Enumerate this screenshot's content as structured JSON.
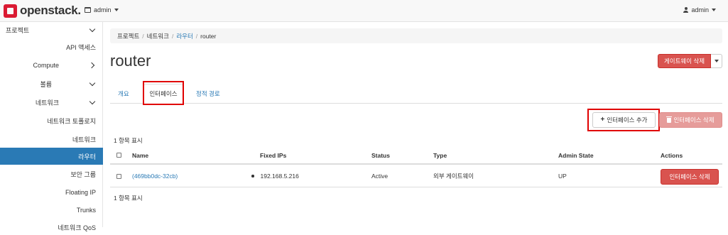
{
  "header": {
    "logo_text": "openstack.",
    "project_menu": "admin",
    "user_menu": "admin"
  },
  "sidebar": {
    "items": [
      {
        "label": "프로젝트",
        "kind": "group",
        "chevron": "down"
      },
      {
        "label": "API 액세스",
        "kind": "sub"
      },
      {
        "label": "Compute",
        "kind": "sub",
        "chevron": "right"
      },
      {
        "label": "볼륨",
        "kind": "sub",
        "chevron": "right"
      },
      {
        "label": "네트워크",
        "kind": "sub",
        "chevron": "down"
      },
      {
        "label": "네트워크 토폴로지",
        "kind": "sub"
      },
      {
        "label": "네트워크",
        "kind": "sub"
      },
      {
        "label": "라우터",
        "kind": "sub",
        "active": true
      },
      {
        "label": "보안 그룹",
        "kind": "sub"
      },
      {
        "label": "Floating IP",
        "kind": "sub"
      },
      {
        "label": "Trunks",
        "kind": "sub"
      },
      {
        "label": "네트워크 QoS",
        "kind": "sub"
      }
    ]
  },
  "breadcrumb": {
    "items": [
      "프로젝트",
      "네트워크",
      "라우터",
      "router"
    ]
  },
  "page": {
    "title": "router",
    "delete_gateway_label": "게이트웨이 삭제"
  },
  "tabs": [
    {
      "label": "개요"
    },
    {
      "label": "인터페이스",
      "active": true
    },
    {
      "label": "정적 경로"
    }
  ],
  "actions": {
    "add_interface_label": "인터페이스 추가",
    "delete_interfaces_label": "인터페이스 삭제"
  },
  "table": {
    "count_label_top": "1 항목 표시",
    "count_label_bottom": "1 항목 표시",
    "columns": [
      "Name",
      "Fixed IPs",
      "Status",
      "Type",
      "Admin State",
      "Actions"
    ],
    "rows": [
      {
        "name": "(469bb0dc-32cb)",
        "fixed_ip": "192.168.5.216",
        "status": "Active",
        "type": "외부 게이트웨이",
        "admin_state": "UP",
        "action_label": "인터페이스 삭제"
      }
    ]
  },
  "colors": {
    "accent_blue": "#2a7ab5",
    "danger_red": "#d9534f",
    "highlight_red": "#e00000"
  }
}
